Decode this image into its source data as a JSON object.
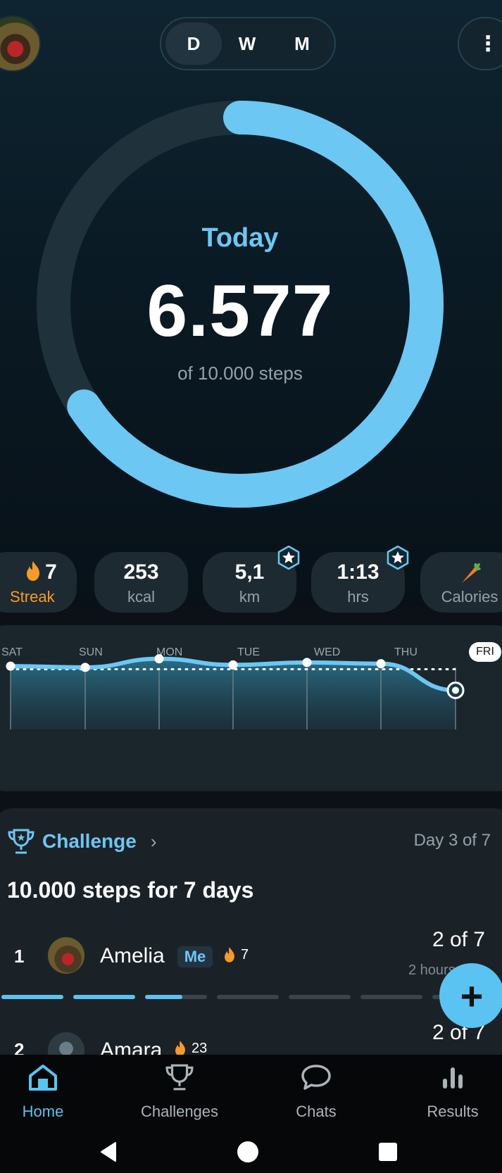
{
  "header": {
    "periods": [
      "D",
      "W",
      "M"
    ],
    "active_period": "D",
    "menu_icon": "more-vertical-icon"
  },
  "ring": {
    "label": "Today",
    "steps": "6.577",
    "goal_text": "of 10.000 steps",
    "progress": 0.6577,
    "color": "#6cc7f2"
  },
  "stats": [
    {
      "value": "7",
      "label": "Streak",
      "icon": "flame-icon"
    },
    {
      "value": "253",
      "label": "kcal"
    },
    {
      "value": "5,1",
      "label": "km",
      "badge": "star-badge-icon"
    },
    {
      "value": "1:13",
      "label": "hrs",
      "badge": "star-badge-icon"
    },
    {
      "value": "",
      "label": "Calories",
      "icon": "carrot-icon"
    }
  ],
  "chart": {
    "days": [
      "SAT",
      "SUN",
      "MON",
      "TUE",
      "WED",
      "THU",
      "FRI"
    ],
    "selected_day": "FRI"
  },
  "chart_data": {
    "type": "area",
    "x": [
      "SAT",
      "SUN",
      "MON",
      "TUE",
      "WED",
      "THU",
      "FRI"
    ],
    "values": [
      10500,
      10300,
      11700,
      10700,
      11100,
      10900,
      6577
    ],
    "goal": 10000,
    "ylim": [
      0,
      16000
    ]
  },
  "challenge": {
    "title": "Challenge",
    "day_text": "Day 3 of 7",
    "goal": "10.000 steps for 7 days",
    "rows": [
      {
        "rank": "1",
        "name": "Amelia",
        "tag": "Me",
        "streak": "7",
        "score": "2 of 7",
        "time": "2 hours"
      },
      {
        "rank": "2",
        "name": "Amara",
        "streak": "23",
        "score": "2 of 7"
      }
    ],
    "progress_days_complete": 2,
    "progress_day_partial": 0.6
  },
  "fab": {
    "label": "+"
  },
  "nav": [
    {
      "label": "Home",
      "icon": "home-icon",
      "active": true
    },
    {
      "label": "Challenges",
      "icon": "trophy-icon",
      "active": false
    },
    {
      "label": "Chats",
      "icon": "chat-bubble-icon",
      "active": false
    },
    {
      "label": "Results",
      "icon": "bar-chart-icon",
      "active": false
    }
  ],
  "system_nav": [
    "back-icon",
    "home-circle-icon",
    "recents-icon"
  ],
  "colors": {
    "accent": "#6cc7f2",
    "streak": "#f59b2b",
    "bg": "#0b1116"
  }
}
